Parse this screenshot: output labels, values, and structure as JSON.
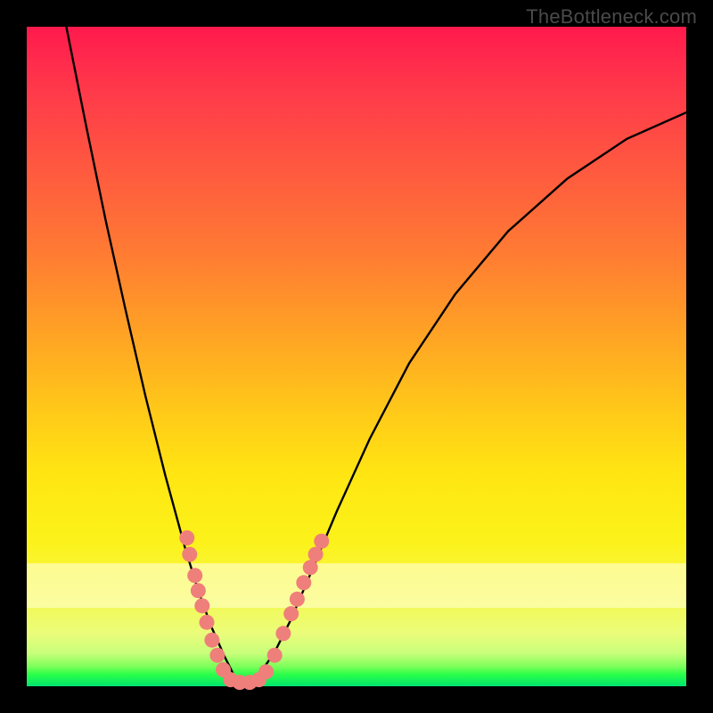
{
  "watermark": "TheBottleneck.com",
  "colors": {
    "marker": "#ef7f7a",
    "curve": "#000000"
  },
  "chart_data": {
    "type": "line",
    "title": "",
    "xlabel": "",
    "ylabel": "",
    "xlim": [
      0,
      1
    ],
    "ylim": [
      0,
      1
    ],
    "grid": false,
    "legend": false,
    "annotations": [
      {
        "text": "TheBottleneck.com",
        "position": "top-right"
      }
    ],
    "note": "Axes are unlabeled; x and y expressed as plot-fraction (0..1, y=0 top). Curve is a V/asymmetric well with minimum near x≈0.33 at plot bottom.",
    "series": [
      {
        "name": "bottleneck-curve",
        "x": [
          0.06,
          0.09,
          0.12,
          0.15,
          0.18,
          0.21,
          0.24,
          0.26,
          0.28,
          0.3,
          0.315,
          0.33,
          0.35,
          0.375,
          0.4,
          0.43,
          0.47,
          0.52,
          0.58,
          0.65,
          0.73,
          0.82,
          0.91,
          1.0
        ],
        "y": [
          0.0,
          0.15,
          0.295,
          0.43,
          0.56,
          0.68,
          0.79,
          0.855,
          0.91,
          0.955,
          0.985,
          0.995,
          0.985,
          0.95,
          0.9,
          0.83,
          0.735,
          0.625,
          0.51,
          0.405,
          0.31,
          0.23,
          0.17,
          0.13
        ]
      }
    ],
    "markers": {
      "name": "highlighted-points",
      "note": "Salmon dots clustered on the valley walls near the bottom",
      "points": [
        {
          "x": 0.243,
          "y": 0.775
        },
        {
          "x": 0.247,
          "y": 0.8
        },
        {
          "x": 0.255,
          "y": 0.832
        },
        {
          "x": 0.26,
          "y": 0.855
        },
        {
          "x": 0.266,
          "y": 0.878
        },
        {
          "x": 0.273,
          "y": 0.903
        },
        {
          "x": 0.281,
          "y": 0.93
        },
        {
          "x": 0.289,
          "y": 0.953
        },
        {
          "x": 0.298,
          "y": 0.975
        },
        {
          "x": 0.309,
          "y": 0.99
        },
        {
          "x": 0.323,
          "y": 0.994
        },
        {
          "x": 0.338,
          "y": 0.994
        },
        {
          "x": 0.352,
          "y": 0.99
        },
        {
          "x": 0.363,
          "y": 0.978
        },
        {
          "x": 0.376,
          "y": 0.953
        },
        {
          "x": 0.389,
          "y": 0.92
        },
        {
          "x": 0.401,
          "y": 0.89
        },
        {
          "x": 0.41,
          "y": 0.868
        },
        {
          "x": 0.42,
          "y": 0.843
        },
        {
          "x": 0.43,
          "y": 0.82
        },
        {
          "x": 0.438,
          "y": 0.8
        },
        {
          "x": 0.447,
          "y": 0.78
        }
      ]
    }
  }
}
